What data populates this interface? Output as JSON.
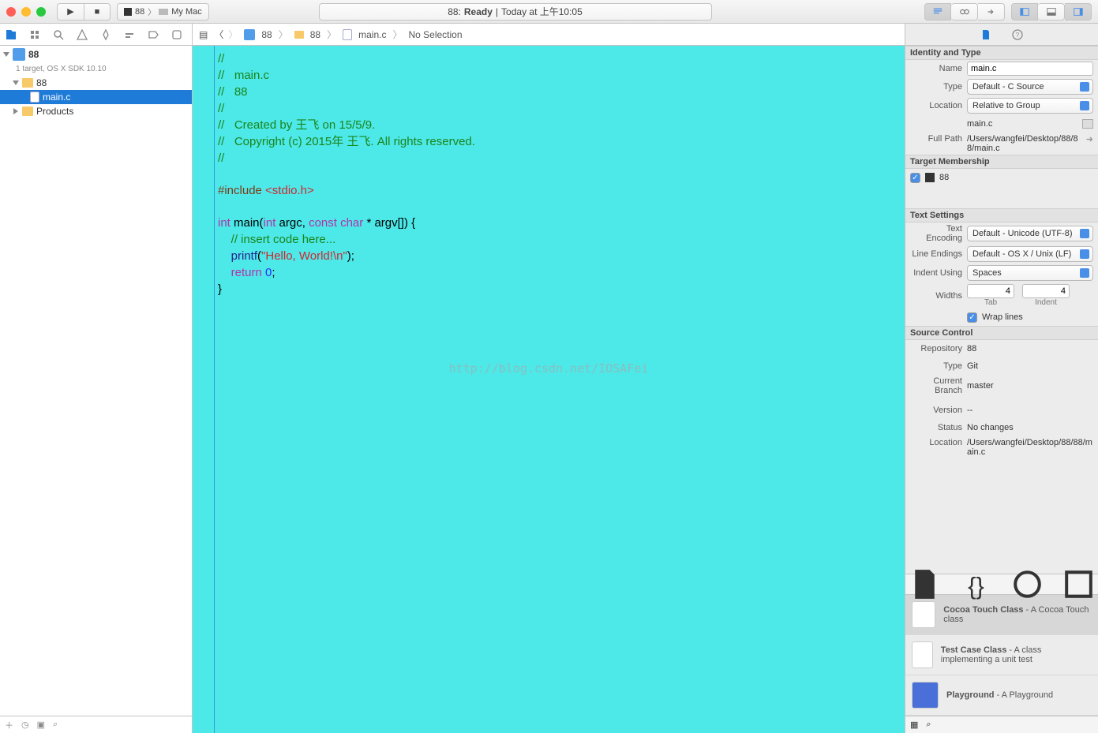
{
  "toolbar": {
    "scheme_target": "88",
    "scheme_device": "My Mac",
    "status_prefix": "88:",
    "status_state": "Ready",
    "status_sep": "|",
    "status_time": "Today at 上午10:05"
  },
  "navigator": {
    "project_name": "88",
    "project_subtitle": "1 target, OS X SDK 10.10",
    "folder_root": "88",
    "file_main": "main.c",
    "folder_products": "Products"
  },
  "jumpbar": {
    "p1": "88",
    "p2": "88",
    "p3": "main.c",
    "p4": "No Selection"
  },
  "code": {
    "l1": "//",
    "l2": "//   main.c",
    "l3": "//   88",
    "l4": "//",
    "l5": "//   Created by 王飞 on 15/5/9.",
    "l6": "//   Copyright (c) 2015年 王飞. All rights reserved.",
    "l7": "//",
    "inc_a": "#include ",
    "inc_b": "<stdio.h>",
    "main_a": "int",
    "main_b": " main(",
    "main_c": "int",
    "main_d": " argc, ",
    "main_e": "const",
    "main_f": " ",
    "main_g": "char",
    "main_h": " * argv[]) {",
    "ins": "    // insert code here...",
    "pf_a": "    printf",
    "pf_b": "(",
    "pf_c": "\"Hello, World!\\n\"",
    "pf_d": ");",
    "ret_a": "    return",
    "ret_b": " ",
    "ret_c": "0",
    "ret_d": ";",
    "brace": "}"
  },
  "watermark": "http://blog.csdn.net/IOSAFei",
  "inspector": {
    "identity_hdr": "Identity and Type",
    "name_lbl": "Name",
    "name_val": "main.c",
    "type_lbl": "Type",
    "type_val": "Default - C Source",
    "location_lbl": "Location",
    "location_val": "Relative to Group",
    "location_file": "main.c",
    "fullpath_lbl": "Full Path",
    "fullpath_val": "/Users/wangfei/Desktop/88/88/main.c",
    "target_hdr": "Target Membership",
    "target_name": "88",
    "text_hdr": "Text Settings",
    "enc_lbl": "Text Encoding",
    "enc_val": "Default - Unicode (UTF-8)",
    "le_lbl": "Line Endings",
    "le_val": "Default - OS X / Unix (LF)",
    "indent_lbl": "Indent Using",
    "indent_val": "Spaces",
    "widths_lbl": "Widths",
    "widths_tab": "4",
    "widths_indent": "4",
    "widths_tab_cap": "Tab",
    "widths_indent_cap": "Indent",
    "wrap_lbl": "Wrap lines",
    "sc_hdr": "Source Control",
    "sc_repo_lbl": "Repository",
    "sc_repo_val": "88",
    "sc_type_lbl": "Type",
    "sc_type_val": "Git",
    "sc_branch_lbl": "Current Branch",
    "sc_branch_val": "master",
    "sc_ver_lbl": "Version",
    "sc_ver_val": "--",
    "sc_status_lbl": "Status",
    "sc_status_val": "No changes",
    "sc_loc_lbl": "Location",
    "sc_loc_val": "/Users/wangfei/Desktop/88/88/main.c"
  },
  "library": {
    "items": [
      {
        "title": "Cocoa Touch Class",
        "desc": " - A Cocoa Touch class"
      },
      {
        "title": "Test Case Class",
        "desc": " - A class implementing a unit test"
      },
      {
        "title": "Playground",
        "desc": " - A Playground"
      }
    ]
  }
}
